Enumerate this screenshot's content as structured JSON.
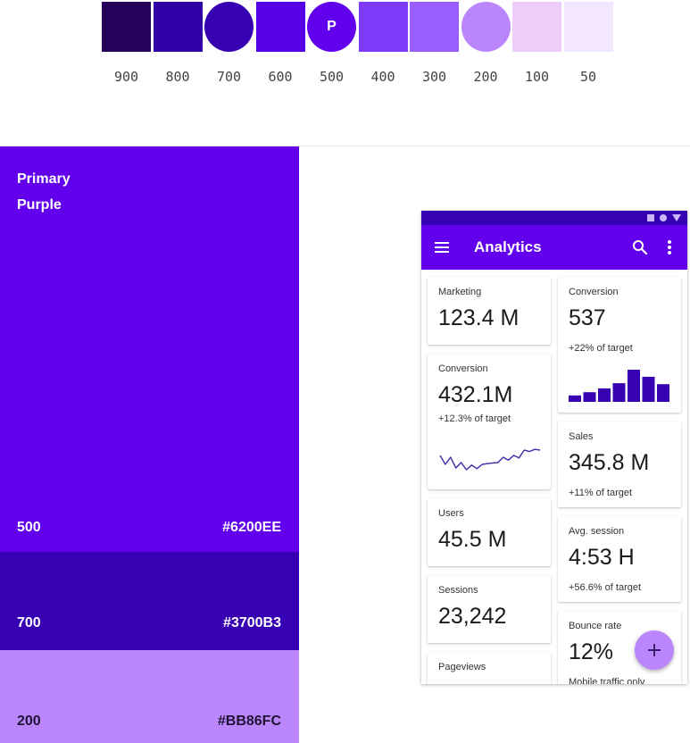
{
  "palette": {
    "swatches": [
      {
        "label": "900",
        "color": "#25005C"
      },
      {
        "label": "800",
        "color": "#3000A6"
      },
      {
        "label": "700",
        "color": "#3700B3",
        "shape": "circle"
      },
      {
        "label": "600",
        "color": "#5600E8"
      },
      {
        "label": "500",
        "color": "#6200EE",
        "shape": "circle",
        "letter": "P"
      },
      {
        "label": "400",
        "color": "#7F39FB"
      },
      {
        "label": "300",
        "color": "#985EFF"
      },
      {
        "label": "200",
        "color": "#BB86FC",
        "shape": "circle"
      },
      {
        "label": "100",
        "color": "#EFCDFA"
      },
      {
        "label": "50",
        "color": "#F2E7FE"
      }
    ]
  },
  "primary": {
    "title_line1": "Primary",
    "title_line2": "Purple",
    "blocks": [
      {
        "name": "500",
        "hex": "#6200EE"
      },
      {
        "name": "700",
        "hex": "#3700B3"
      },
      {
        "name": "200",
        "hex": "#BB86FC"
      }
    ]
  },
  "phone": {
    "app_title": "Analytics",
    "icons": {
      "menu": "menu-icon",
      "search": "search-icon",
      "more": "more-vert-icon",
      "fab": "add-icon"
    },
    "cards": {
      "marketing": {
        "title": "Marketing",
        "value": "123.4 M"
      },
      "conversion_left": {
        "title": "Conversion",
        "value": "432.1M",
        "sub": "+12.3% of target"
      },
      "users": {
        "title": "Users",
        "value": "45.5 M"
      },
      "sessions": {
        "title": "Sessions",
        "value": "23,242"
      },
      "pageviews": {
        "title": "Pageviews"
      },
      "conversion_right": {
        "title": "Conversion",
        "value": "537",
        "sub": "+22% of target"
      },
      "sales": {
        "title": "Sales",
        "value": "345.8 M",
        "sub": "+11% of target"
      },
      "avg_session": {
        "title": "Avg. session",
        "value": "4:53 H",
        "sub": "+56.6% of target"
      },
      "bounce": {
        "title": "Bounce rate",
        "value": "12%",
        "sub": "Mobile traffic only"
      }
    },
    "sparkline_values": [
      0.55,
      0.3,
      0.5,
      0.2,
      0.35,
      0.15,
      0.28,
      0.18,
      0.3,
      0.32,
      0.34,
      0.35,
      0.5,
      0.42,
      0.55,
      0.48,
      0.7,
      0.66,
      0.72,
      0.7
    ],
    "bar_values": [
      0.2,
      0.3,
      0.42,
      0.58,
      1.0,
      0.78,
      0.55
    ]
  }
}
